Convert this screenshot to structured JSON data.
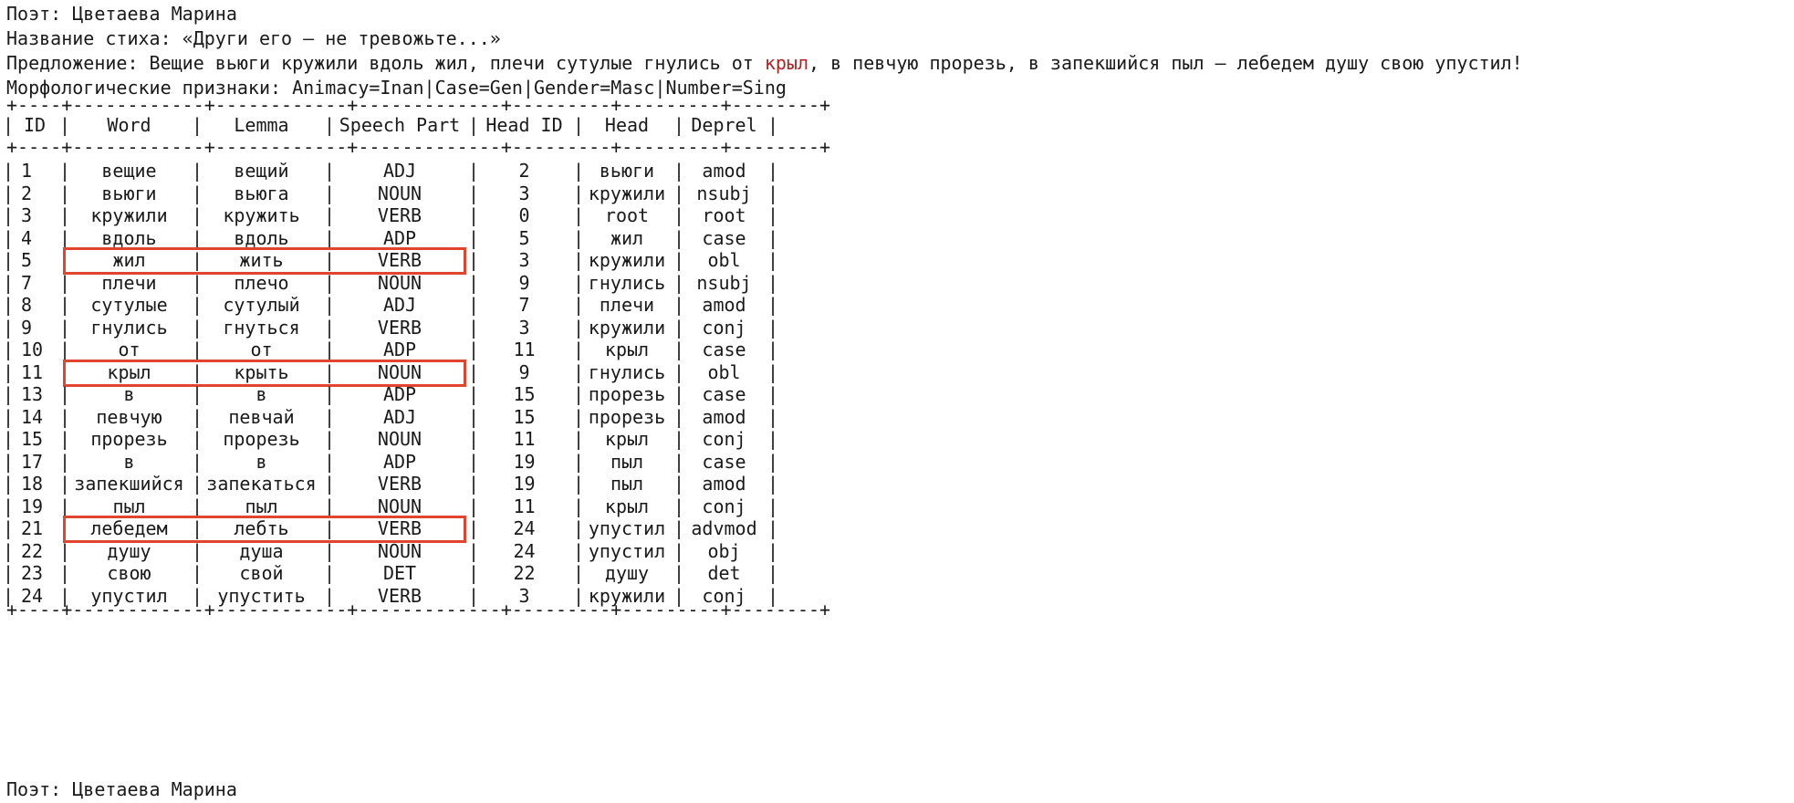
{
  "header": {
    "poet_label": "Поэт: Цветаева Марина",
    "title_label": "Название стиха: «Други его — не тревожьте...»",
    "sentence_prefix": "Предложение: Вещие вьюги кружили вдоль жил, плечи сутулые гнулись от ",
    "sentence_highlight": "крыл",
    "sentence_suffix": ", в певчую прорезь, в запекшийся пыл — лебедем душу свою упустил!",
    "morph_label": "Морфологические признаки: Animacy=Inan|Case=Gen|Gender=Masc|Number=Sing"
  },
  "table": {
    "border_line": "+----+------------+------------+-------------+---------+---------+--------+",
    "columns": [
      "ID",
      "Word",
      "Lemma",
      "Speech Part",
      "Head ID",
      "Head",
      "Deprel"
    ],
    "rows": [
      {
        "id": "1",
        "word": "вещие",
        "lemma": "вещий",
        "pos": "ADJ",
        "head_id": "2",
        "head": "вьюги",
        "deprel": "amod",
        "hl": false
      },
      {
        "id": "2",
        "word": "вьюги",
        "lemma": "вьюга",
        "pos": "NOUN",
        "head_id": "3",
        "head": "кружили",
        "deprel": "nsubj",
        "hl": false
      },
      {
        "id": "3",
        "word": "кружили",
        "lemma": "кружить",
        "pos": "VERB",
        "head_id": "0",
        "head": "root",
        "deprel": "root",
        "hl": false
      },
      {
        "id": "4",
        "word": "вдоль",
        "lemma": "вдоль",
        "pos": "ADP",
        "head_id": "5",
        "head": "жил",
        "deprel": "case",
        "hl": false
      },
      {
        "id": "5",
        "word": "жил",
        "lemma": "жить",
        "pos": "VERB",
        "head_id": "3",
        "head": "кружили",
        "deprel": "obl",
        "hl": true
      },
      {
        "id": "7",
        "word": "плечи",
        "lemma": "плечо",
        "pos": "NOUN",
        "head_id": "9",
        "head": "гнулись",
        "deprel": "nsubj",
        "hl": false
      },
      {
        "id": "8",
        "word": "сутулые",
        "lemma": "сутулый",
        "pos": "ADJ",
        "head_id": "7",
        "head": "плечи",
        "deprel": "amod",
        "hl": false
      },
      {
        "id": "9",
        "word": "гнулись",
        "lemma": "гнуться",
        "pos": "VERB",
        "head_id": "3",
        "head": "кружили",
        "deprel": "conj",
        "hl": false
      },
      {
        "id": "10",
        "word": "от",
        "lemma": "от",
        "pos": "ADP",
        "head_id": "11",
        "head": "крыл",
        "deprel": "case",
        "hl": false
      },
      {
        "id": "11",
        "word": "крыл",
        "lemma": "крыть",
        "pos": "NOUN",
        "head_id": "9",
        "head": "гнулись",
        "deprel": "obl",
        "hl": true
      },
      {
        "id": "13",
        "word": "в",
        "lemma": "в",
        "pos": "ADP",
        "head_id": "15",
        "head": "прорезь",
        "deprel": "case",
        "hl": false
      },
      {
        "id": "14",
        "word": "певчую",
        "lemma": "певчай",
        "pos": "ADJ",
        "head_id": "15",
        "head": "прорезь",
        "deprel": "amod",
        "hl": false
      },
      {
        "id": "15",
        "word": "прорезь",
        "lemma": "прорезь",
        "pos": "NOUN",
        "head_id": "11",
        "head": "крыл",
        "deprel": "conj",
        "hl": false
      },
      {
        "id": "17",
        "word": "в",
        "lemma": "в",
        "pos": "ADP",
        "head_id": "19",
        "head": "пыл",
        "deprel": "case",
        "hl": false
      },
      {
        "id": "18",
        "word": "запекшийся",
        "lemma": "запекаться",
        "pos": "VERB",
        "head_id": "19",
        "head": "пыл",
        "deprel": "amod",
        "hl": false
      },
      {
        "id": "19",
        "word": "пыл",
        "lemma": "пыл",
        "pos": "NOUN",
        "head_id": "11",
        "head": "крыл",
        "deprel": "conj",
        "hl": false
      },
      {
        "id": "21",
        "word": "лебедем",
        "lemma": "лебть",
        "pos": "VERB",
        "head_id": "24",
        "head": "упустил",
        "deprel": "advmod",
        "hl": true
      },
      {
        "id": "22",
        "word": "душу",
        "lemma": "душа",
        "pos": "NOUN",
        "head_id": "24",
        "head": "упустил",
        "deprel": "obj",
        "hl": false
      },
      {
        "id": "23",
        "word": "свою",
        "lemma": "свой",
        "pos": "DET",
        "head_id": "22",
        "head": "душу",
        "deprel": "det",
        "hl": false
      },
      {
        "id": "24",
        "word": "упустил",
        "lemma": "упустить",
        "pos": "VERB",
        "head_id": "3",
        "head": "кружили",
        "deprel": "conj",
        "hl": false
      }
    ]
  },
  "footer": {
    "next_poet_label": "Поэт: Цветаева Марина"
  },
  "colors": {
    "highlight_box": "#e0452e",
    "highlight_word": "#b22222"
  }
}
